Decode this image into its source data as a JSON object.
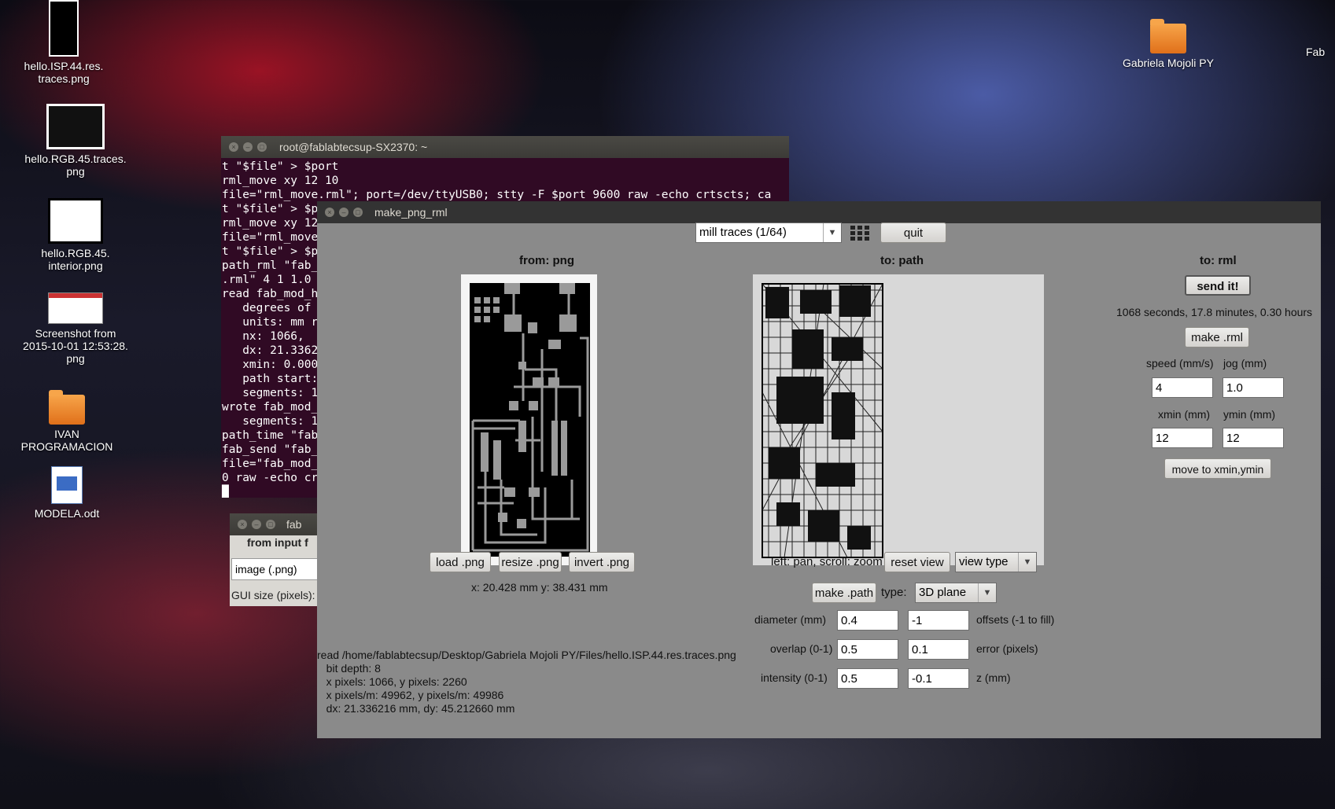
{
  "desktop": {
    "icons": [
      {
        "label": "hello.ISP.44.res.\ntraces.png"
      },
      {
        "label": "hello.RGB.45.traces.\npng"
      },
      {
        "label": "hello.RGB.45.\ninterior.png"
      },
      {
        "label": "Screenshot from\n2015-10-01 12:53:28.\npng"
      },
      {
        "label": "IVAN\nPROGRAMACION"
      },
      {
        "label": "MODELA.odt"
      },
      {
        "label": "Gabriela Mojoli PY"
      },
      {
        "label": "Fab"
      }
    ]
  },
  "terminal": {
    "title": "root@fablabtecsup-SX2370: ~",
    "lines": [
      "t \"$file\" > $port",
      "rml_move xy 12 10",
      "file=\"rml_move.rml\"; port=/dev/ttyUSB0; stty -F $port 9600 raw -echo crtscts; ca",
      "t \"$file\" > $p",
      "rml_move xy 12",
      "file=\"rml_move",
      "t \"$file\" > $p",
      "path_rml \"fab_",
      ".rml\" 4 1 1.0",
      "read fab_mod_h",
      "   degrees of",
      "   units: mm r",
      "   nx: 1066,",
      "   dx: 21.3362",
      "   xmin: 0.000",
      "   path start:",
      "   segments: 1",
      "wrote fab_mod_",
      "   segments: 1",
      "path_time \"fab",
      "fab_send \"fab_",
      "file=\"fab_mod_",
      "0 raw -echo cr",
      "█"
    ]
  },
  "fab": {
    "title": "fab",
    "from_input": "from input f",
    "input_value": "image (.png)",
    "gui_size": "GUI size (pixels):"
  },
  "app": {
    "title": "make_png_rml",
    "mode": "mill traces (1/64)",
    "quit": "quit",
    "from_png": "from: png",
    "to_path": "to: path",
    "to_rml": "to: rml",
    "load_png": "load .png",
    "resize_png": "resize .png",
    "invert_png": "invert .png",
    "coords": "x: 20.428 mm  y: 38.431 mm",
    "pan_hint": "left: pan, scroll: zoom",
    "reset_view": "reset view",
    "view_type": "view type",
    "make_path": "make .path",
    "type_label": "type:",
    "type_value": "3D plane",
    "diameter_label": "diameter (mm)",
    "diameter": "0.4",
    "offsets": "-1",
    "offsets_label": "offsets (-1 to fill)",
    "overlap_label": "overlap (0-1)",
    "overlap": "0.5",
    "error": "0.1",
    "error_label": "error (pixels)",
    "intensity_label": "intensity (0-1)",
    "intensity": "0.5",
    "z": "-0.1",
    "z_label": "z (mm)",
    "send_it": "send it!",
    "time_info": "1068 seconds, 17.8 minutes, 0.30 hours",
    "make_rml": "make .rml",
    "speed_label": "speed (mm/s)",
    "jog_label": "jog (mm)",
    "speed": "4",
    "jog": "1.0",
    "xmin_label": "xmin (mm)",
    "ymin_label": "ymin (mm)",
    "xmin": "12",
    "ymin": "12",
    "move_btn": "move to xmin,ymin",
    "log": "read /home/fablabtecsup/Desktop/Gabriela Mojoli PY/Files/hello.ISP.44.res.traces.png\n   bit depth: 8\n   x pixels: 1066, y pixels: 2260\n   x pixels/m: 49962, y pixels/m: 49986\n   dx: 21.336216 mm, dy: 45.212660 mm"
  }
}
